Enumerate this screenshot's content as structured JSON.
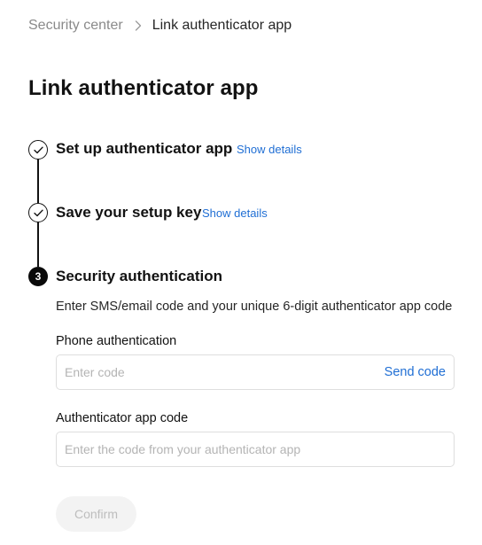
{
  "breadcrumb": {
    "parent": "Security center",
    "separator_icon": "chevron-right-icon",
    "current": "Link authenticator app"
  },
  "page": {
    "title": "Link authenticator app"
  },
  "steps": [
    {
      "status": "completed",
      "icon": "check-icon",
      "title": "Set up authenticator app",
      "link": "Show details"
    },
    {
      "status": "completed",
      "icon": "check-icon",
      "title": "Save your setup key",
      "link": "Show details"
    },
    {
      "status": "current",
      "number": "3",
      "title": "Security authentication",
      "description": "Enter SMS/email code and your unique 6-digit authenticator app code"
    }
  ],
  "form": {
    "phone": {
      "label": "Phone authentication",
      "placeholder": "Enter code",
      "value": "",
      "action": "Send code"
    },
    "authenticator": {
      "label": "Authenticator app code",
      "placeholder": "Enter the code from your authenticator app",
      "value": ""
    },
    "confirm_label": "Confirm",
    "confirm_disabled": true
  },
  "colors": {
    "text_primary": "#121212",
    "text_muted": "#8a8a8a",
    "link": "#1f6ed4",
    "border": "#dedede",
    "button_disabled_bg": "#f3f3f3",
    "button_disabled_text": "#bdbdbd"
  }
}
